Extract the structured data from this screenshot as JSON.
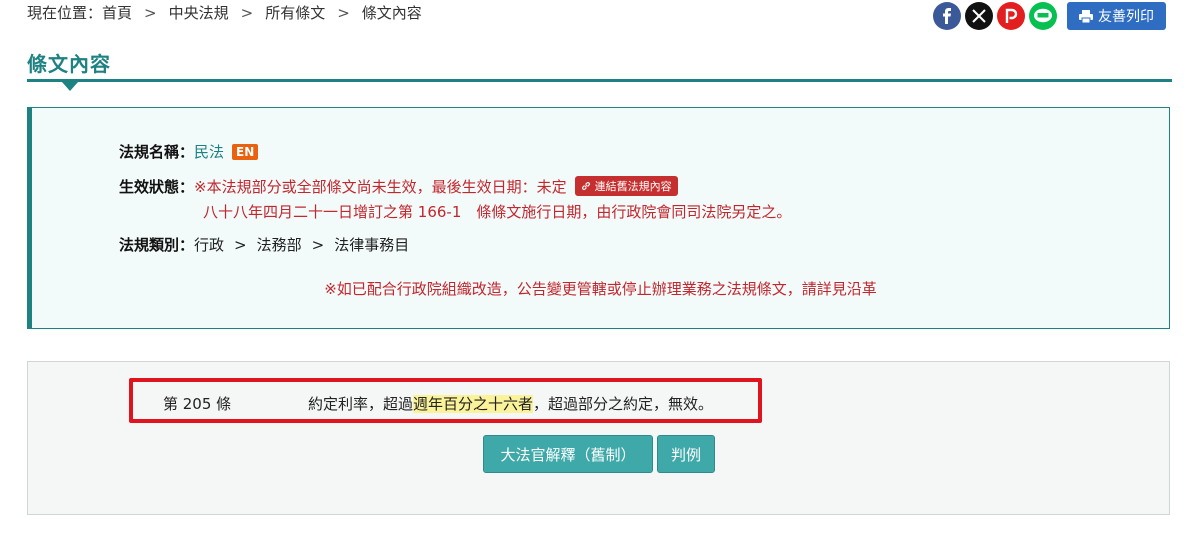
{
  "breadcrumb": {
    "prefix": "現在位置：",
    "items": [
      "首頁",
      "中央法規",
      "所有條文",
      "條文內容"
    ],
    "separator": ">"
  },
  "social": {
    "facebook_icon": "facebook-icon",
    "x_icon": "x-icon",
    "plurk_icon": "plurk-icon",
    "line_icon": "line-icon",
    "print_label": "友善列印"
  },
  "page": {
    "title": "條文內容"
  },
  "law_info": {
    "name_label": "法規名稱：",
    "name_value": "民法",
    "en_badge": "EN",
    "status_label": "生效狀態：",
    "status_value": "※本法規部分或全部條文尚未生效，最後生效日期：未定",
    "old_link_label": "連結舊法規內容",
    "status_note": "八十八年四月二十一日增訂之第 166-1　條條文施行日期，由行政院會同司法院另定之。",
    "category_label": "法規類別：",
    "categories": [
      "行政",
      "法務部",
      "法律事務目"
    ],
    "category_separator": ">",
    "notice": "※如已配合行政院組織改造，公告變更管轄或停止辦理業務之法規條文，請詳見沿革"
  },
  "article": {
    "number": "第 205 條",
    "text_before": "約定利率，超過",
    "text_highlight": "週年百分之十六者",
    "text_after": "，超過部分之約定，無效。",
    "buttons": {
      "interpretation": "大法官解釋（舊制）",
      "cases": "判例"
    }
  },
  "colors": {
    "accent": "#1e8282",
    "status_red": "#c1272d",
    "highlight_frame": "#e0141e",
    "text_highlight": "#fbf39a",
    "button_teal": "#3fa9a9",
    "print_blue": "#2f6dc2"
  }
}
